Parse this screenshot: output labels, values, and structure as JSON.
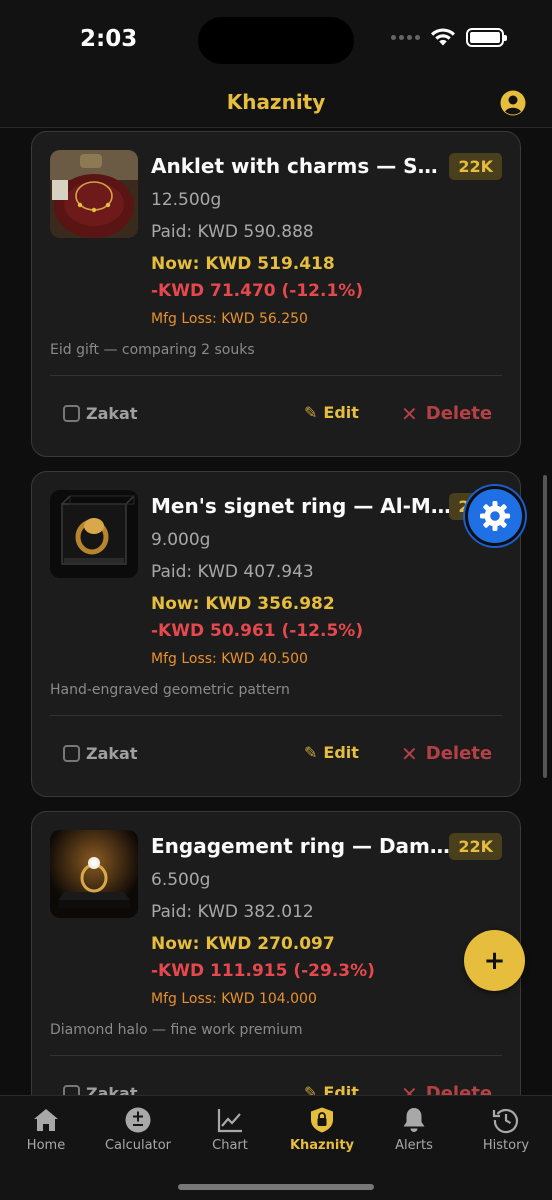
{
  "status_bar": {
    "time": "2:03"
  },
  "header": {
    "title": "Khaznity"
  },
  "items": [
    {
      "name": "Anklet with charms — Salhiya Complex",
      "karat": "22K",
      "weight": "12.500g",
      "paid": "Paid: KWD 590.888",
      "now": "Now: KWD 519.418",
      "change": "-KWD 71.470 (-12.1%)",
      "mfg_loss": "Mfg Loss: KWD 56.250",
      "note": "Eid gift — comparing 2 souks",
      "zakat_label": "Zakat",
      "edit_label": "Edit",
      "delete_label": "Delete"
    },
    {
      "name": "Men's signet ring — Al-Maliya Souk",
      "karat": "22K",
      "weight": "9.000g",
      "paid": "Paid: KWD 407.943",
      "now": "Now: KWD 356.982",
      "change": "-KWD 50.961 (-12.5%)",
      "mfg_loss": "Mfg Loss: KWD 40.500",
      "note": "Hand-engraved geometric pattern",
      "zakat_label": "Zakat",
      "edit_label": "Edit",
      "delete_label": "Delete"
    },
    {
      "name": "Engagement ring — Damascus Jewelers",
      "karat": "22K",
      "weight": "6.500g",
      "paid": "Paid: KWD 382.012",
      "now": "Now: KWD 270.097",
      "change": "-KWD 111.915 (-29.3%)",
      "mfg_loss": "Mfg Loss: KWD 104.000",
      "note": "Diamond halo — fine work premium",
      "zakat_label": "Zakat",
      "edit_label": "Edit",
      "delete_label": "Delete"
    }
  ],
  "fab": {
    "add_label": "+",
    "settings_icon": "gear-icon"
  },
  "nav": [
    {
      "label": "Home",
      "icon": "home-icon"
    },
    {
      "label": "Calculator",
      "icon": "calculator-icon"
    },
    {
      "label": "Chart",
      "icon": "chart-icon"
    },
    {
      "label": "Khaznity",
      "icon": "vault-icon"
    },
    {
      "label": "Alerts",
      "icon": "bell-icon"
    },
    {
      "label": "History",
      "icon": "history-icon"
    }
  ],
  "colors": {
    "accent_gold": "#e6bd3d",
    "loss_red": "#e5484d",
    "mfg_orange": "#e8912e",
    "settings_blue": "#1f6fe5",
    "background": "#0e0e0e",
    "card": "#1c1c1c"
  }
}
